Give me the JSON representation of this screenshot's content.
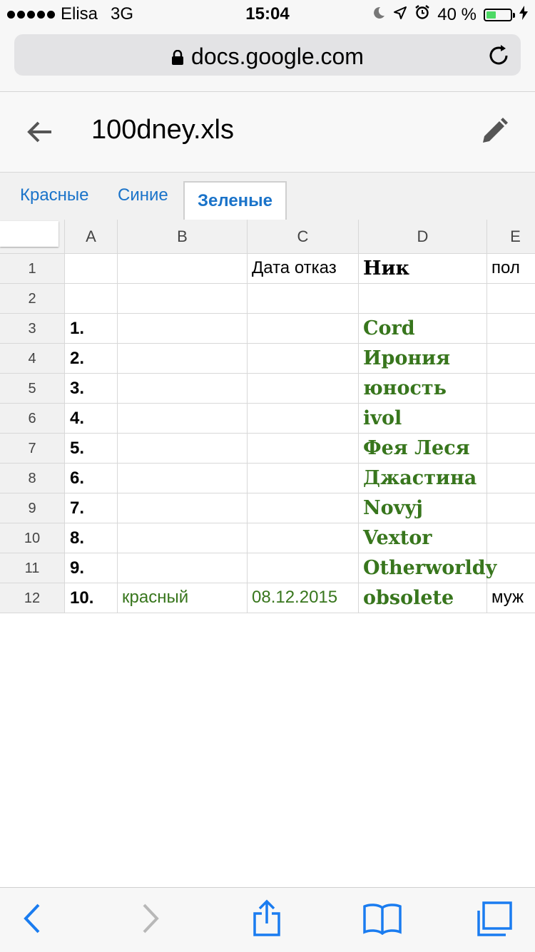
{
  "status": {
    "carrier": "Elisa",
    "network": "3G",
    "time": "15:04",
    "battery": "40 %",
    "battery_level": 0.4
  },
  "browser": {
    "url": "docs.google.com"
  },
  "app": {
    "title": "100dney.xls"
  },
  "tabs": [
    "Красные",
    "Синие",
    "Зеленые"
  ],
  "columns": [
    "A",
    "B",
    "C",
    "D",
    "E"
  ],
  "rows": [
    {
      "n": "1",
      "a": "",
      "b": "",
      "c": "Дата отказ",
      "d": "Ник",
      "e": "пол"
    },
    {
      "n": "2",
      "a": "",
      "b": "",
      "c": "",
      "d": "",
      "e": ""
    },
    {
      "n": "3",
      "a": "1.",
      "b": "",
      "c": "",
      "d": "Cord",
      "e": ""
    },
    {
      "n": "4",
      "a": "2.",
      "b": "",
      "c": "",
      "d": "Ирония",
      "e": ""
    },
    {
      "n": "5",
      "a": "3.",
      "b": "",
      "c": "",
      "d": "юность",
      "e": ""
    },
    {
      "n": "6",
      "a": "4.",
      "b": "",
      "c": "",
      "d": "ivol",
      "e": ""
    },
    {
      "n": "7",
      "a": "5.",
      "b": "",
      "c": "",
      "d": "Фея Леся",
      "e": ""
    },
    {
      "n": "8",
      "a": "6.",
      "b": "",
      "c": "",
      "d": "Джастина",
      "e": ""
    },
    {
      "n": "9",
      "a": "7.",
      "b": "",
      "c": "",
      "d": "Novyj",
      "e": ""
    },
    {
      "n": "10",
      "a": "8.",
      "b": "",
      "c": "",
      "d": "Vextor",
      "e": ""
    },
    {
      "n": "11",
      "a": "9.",
      "b": "",
      "c": "",
      "d": "Otherworldy",
      "e": ""
    },
    {
      "n": "12",
      "a": "10.",
      "b": "красный",
      "c": "08.12.2015",
      "d": "obsolete",
      "e": "муж"
    }
  ]
}
